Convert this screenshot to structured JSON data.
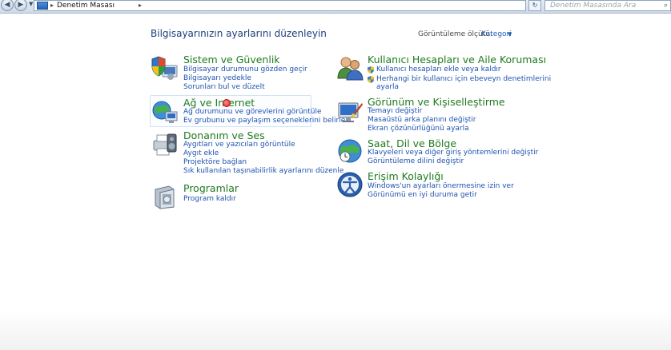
{
  "window": {
    "address_path": "Denetim Masası",
    "search_placeholder": "Denetim Masasında Ara"
  },
  "header": {
    "title": "Bilgisayarınızın ayarlarını düzenleyin",
    "view_by_label": "Görüntüleme ölçütü:",
    "view_by_value": "Kategori"
  },
  "categories_left": [
    {
      "title": "Sistem ve Güvenlik",
      "icon": "security-shield-icon",
      "links": [
        "Bilgisayar durumunu gözden geçir",
        "Bilgisayarı yedekle",
        "Sorunları bul ve düzelt"
      ]
    },
    {
      "title": "Ağ ve Internet",
      "icon": "network-globe-icon",
      "links": [
        "Ağ durumunu ve görevlerini görüntüle",
        "Ev grubunu ve paylaşım seçeneklerini belirle"
      ]
    },
    {
      "title": "Donanım ve Ses",
      "icon": "printer-speaker-icon",
      "links": [
        "Aygıtları ve yazıcıları görüntüle",
        "Aygıt ekle",
        "Projektöre bağlan",
        "Sık kullanılan taşınabilirlik ayarlarını düzenle"
      ]
    },
    {
      "title": "Programlar",
      "icon": "programs-box-icon",
      "links": [
        "Program kaldır"
      ]
    }
  ],
  "categories_right": [
    {
      "title": "Kullanıcı Hesapları ve Aile Koruması",
      "icon": "users-icon",
      "links": [
        "Kullanıcı hesapları ekle veya kaldır",
        "Herhangi bir kullanıcı için ebeveyn denetimlerini",
        "ayarla"
      ]
    },
    {
      "title": "Görünüm ve Kişiselleştirme",
      "icon": "monitor-brush-icon",
      "links": [
        "Temayı değiştir",
        "Masaüstü arka planını değiştir",
        "Ekran çözünürlüğünü ayarla"
      ]
    },
    {
      "title": "Saat, Dil ve Bölge",
      "icon": "clock-globe-icon",
      "links": [
        "Klavyeleri veya diğer giriş yöntemlerini değiştir",
        "Görüntüleme dilini değiştir"
      ]
    },
    {
      "title": "Erişim Kolaylığı",
      "icon": "ease-of-access-icon",
      "links": [
        "Windows'un ayarları önermesine izin ver",
        "Görünümü en iyi duruma getir"
      ]
    }
  ],
  "colors": {
    "title_green": "#1f7a1f",
    "link_blue": "#1e52b0",
    "heading_blue": "#1c3f7a"
  }
}
